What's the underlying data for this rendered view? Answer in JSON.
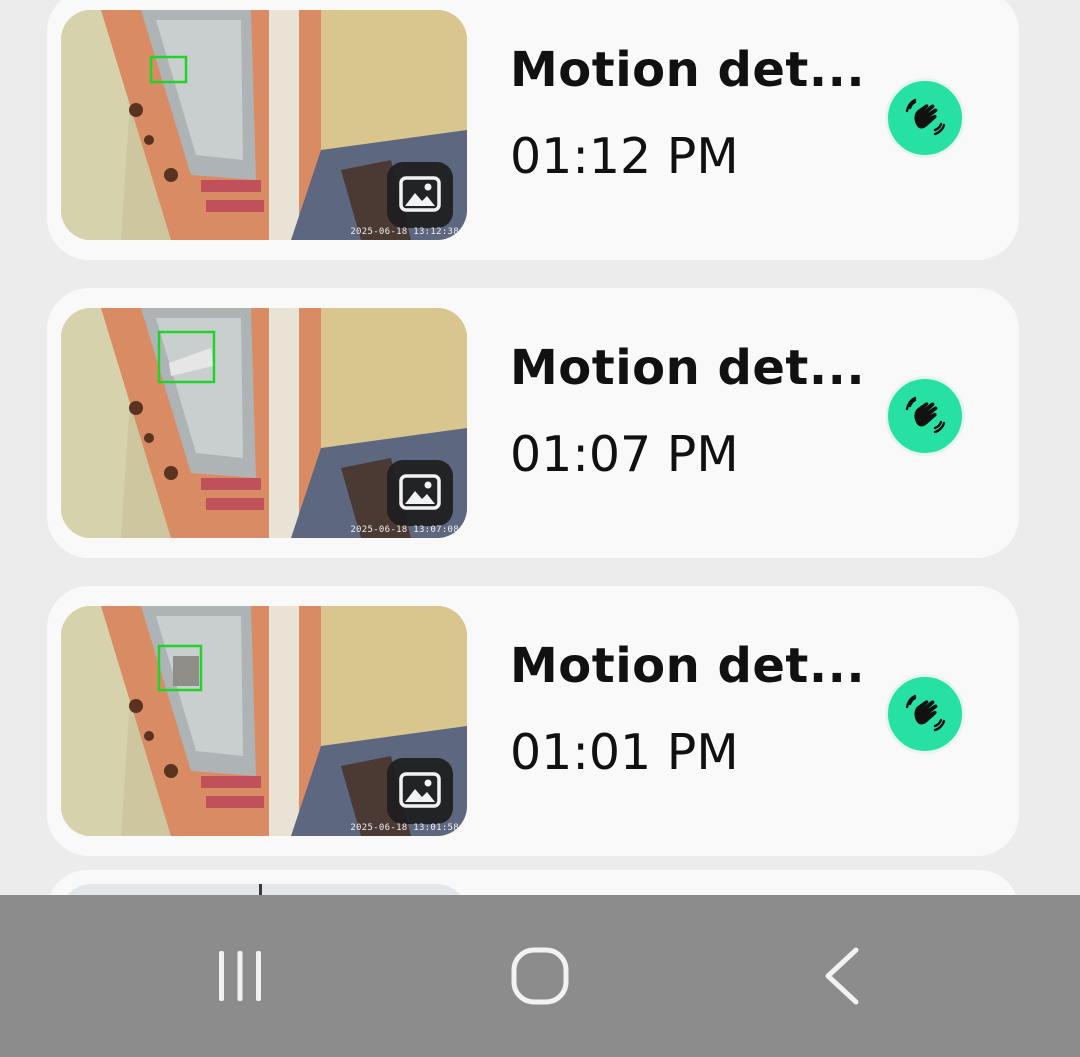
{
  "events": [
    {
      "title": "Motion det...",
      "time": "01:12 PM",
      "stamp": "2025-06-18 13:12:38",
      "event_icon": "wave-hand-icon",
      "media_icon": "image-icon"
    },
    {
      "title": "Motion det...",
      "time": "01:07 PM",
      "stamp": "2025-06-18 13:07:08",
      "event_icon": "wave-hand-icon",
      "media_icon": "image-icon"
    },
    {
      "title": "Motion det...",
      "time": "01:01 PM",
      "stamp": "2025-06-18 13:01:58",
      "event_icon": "wave-hand-icon",
      "media_icon": "image-icon"
    }
  ],
  "navbar": {
    "recent_icon": "recent-apps-icon",
    "home_icon": "home-icon",
    "back_icon": "back-icon"
  },
  "colors": {
    "badge": "#27e0a3",
    "detection_box": "#22d22a",
    "navbar": "#8c8c8c",
    "card": "#f9f9f9",
    "background": "#ececec"
  }
}
